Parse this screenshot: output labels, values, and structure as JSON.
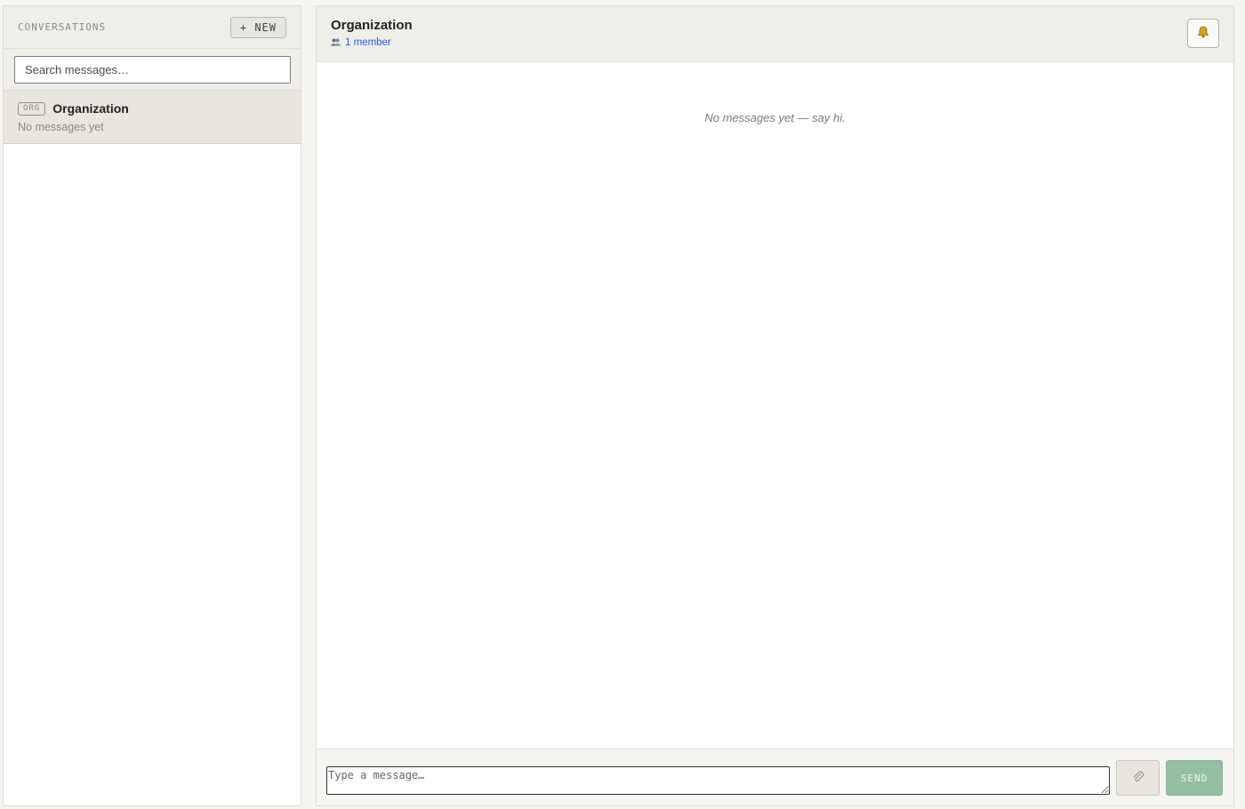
{
  "sidebar": {
    "title": "CONVERSATIONS",
    "new_label": "+ NEW",
    "search": {
      "placeholder": "Search messages…",
      "value": ""
    },
    "conversations": [
      {
        "badge": "ORG",
        "name": "Organization",
        "preview": "No messages yet",
        "selected": true
      }
    ]
  },
  "main": {
    "channel_title": "Organization",
    "members_icon": "people-icon",
    "members_text": "1 member",
    "bell_icon": "bell-icon",
    "empty_text": "No messages yet — say hi.",
    "composer": {
      "placeholder": "Type a message…",
      "attach_icon": "paperclip-icon",
      "send_label": "SEND"
    }
  },
  "colors": {
    "background": "#f6f5f1",
    "panel_header": "#efeee9",
    "selected_row": "#e8e6df",
    "link": "#2d5bcc",
    "send_button": "#96bea2"
  }
}
